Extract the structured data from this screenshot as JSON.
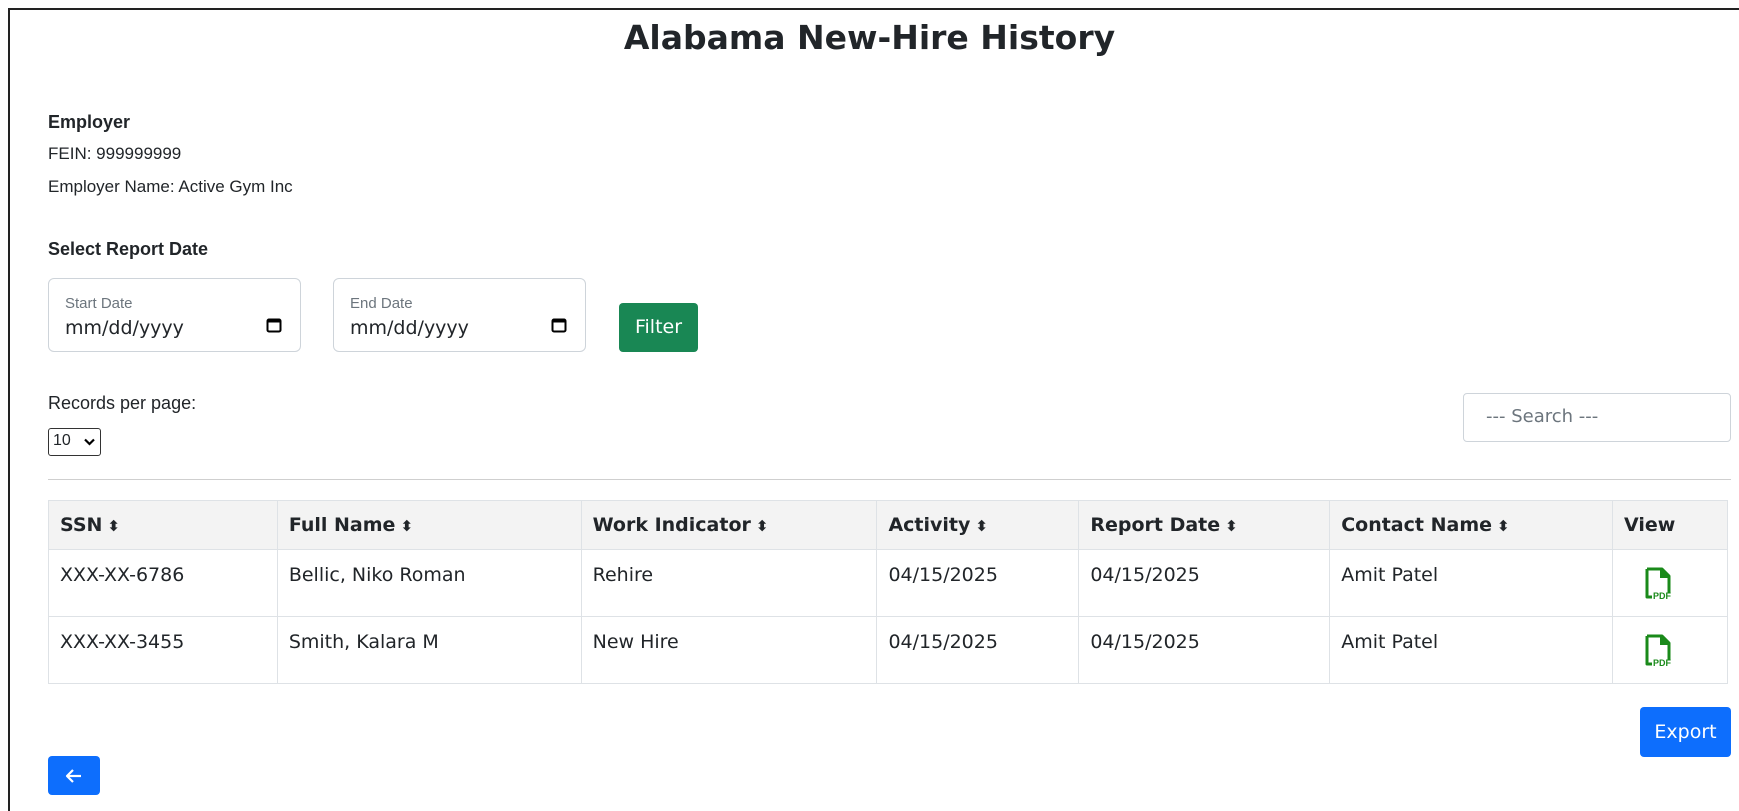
{
  "page": {
    "title": "Alabama New-Hire History"
  },
  "employer": {
    "heading": "Employer",
    "fein": "FEIN: 999999999",
    "name": "Employer Name: Active Gym Inc"
  },
  "report_date": {
    "heading": "Select Report Date",
    "start_label": "Start Date",
    "start_value": "mm/dd/yyyy",
    "end_label": "End Date",
    "end_value": "mm/dd/yyyy",
    "filter_label": "Filter"
  },
  "records": {
    "label": "Records per page:",
    "selected": "10"
  },
  "search": {
    "placeholder": "--- Search ---"
  },
  "table": {
    "columns": [
      {
        "label": "SSN",
        "sort_icon": "sort-icon"
      },
      {
        "label": "Full Name",
        "sort_icon": "sort-icon"
      },
      {
        "label": "Work Indicator",
        "sort_icon": "sort-icon"
      },
      {
        "label": "Activity",
        "sort_icon": "sort-icon"
      },
      {
        "label": "Report Date",
        "sort_icon": "sort-icon"
      },
      {
        "label": "Contact Name",
        "sort_icon": "sort-icon"
      },
      {
        "label": "View"
      }
    ],
    "rows": [
      {
        "ssn": "XXX-XX-6786",
        "full_name": "Bellic, Niko Roman",
        "work_indicator": "Rehire",
        "activity": "04/15/2025",
        "report_date": "04/15/2025",
        "contact_name": "Amit Patel",
        "view_icon": "pdf-icon"
      },
      {
        "ssn": "XXX-XX-3455",
        "full_name": "Smith, Kalara M",
        "work_indicator": "New Hire",
        "activity": "04/15/2025",
        "report_date": "04/15/2025",
        "contact_name": "Amit Patel",
        "view_icon": "pdf-icon"
      }
    ]
  },
  "actions": {
    "export_label": "Export",
    "back_icon": "arrow-left-icon"
  },
  "colors": {
    "primary": "#0d6efd",
    "success": "#198754",
    "pdf_green": "#1a8a1a"
  }
}
